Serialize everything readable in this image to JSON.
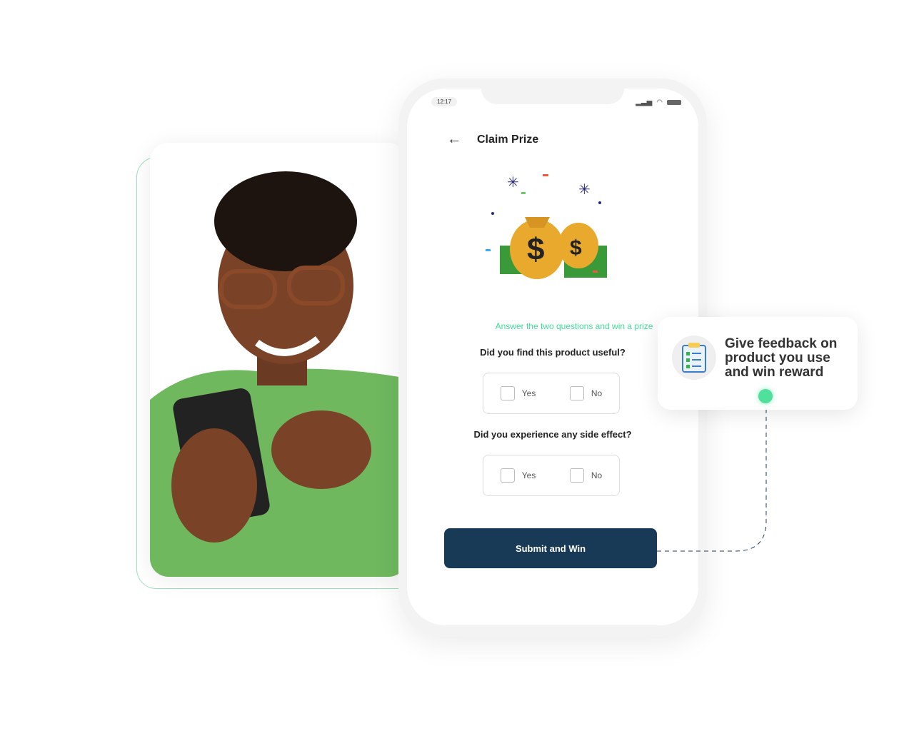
{
  "phone": {
    "status_time": "12:17",
    "header_title": "Claim Prize",
    "hint": "Answer the two questions and win a prize",
    "questions": [
      {
        "text": "Did you find this product useful?",
        "yes": "Yes",
        "no": "No"
      },
      {
        "text": "Did you experience any side effect?",
        "yes": "Yes",
        "no": "No"
      }
    ],
    "submit_label": "Submit and Win"
  },
  "card": {
    "text": "Give feedback on product you use and win reward"
  },
  "colors": {
    "accent": "#3fdc9a",
    "button": "#183a56"
  }
}
